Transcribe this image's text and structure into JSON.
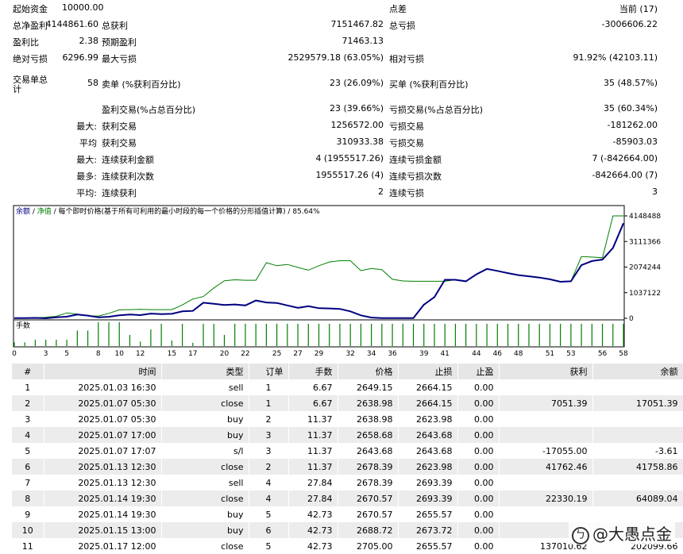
{
  "stats": {
    "initial_deposit": {
      "label": "起始资金",
      "value": "10000.00"
    },
    "spread": {
      "label": "点差",
      "value": "当前 (17)"
    },
    "net_profit": {
      "label": "总净盈利",
      "value": "4144861.60"
    },
    "gross_profit": {
      "label": "总获利",
      "value": "7151467.82"
    },
    "gross_loss": {
      "label": "总亏损",
      "value": "-3006606.22"
    },
    "profit_factor": {
      "label": "盈利比",
      "value": "2.38"
    },
    "expected_payoff": {
      "label": "预期盈利",
      "value": "71463.13"
    },
    "absolute_dd": {
      "label": "绝对亏损",
      "value": "6296.99"
    },
    "max_dd": {
      "label": "最大亏损",
      "value": "2529579.18 (63.05%)"
    },
    "relative_dd": {
      "label": "相对亏损",
      "value": "91.92% (42103.11)"
    },
    "total_trades": {
      "label": "交易单总计",
      "value": "58"
    },
    "short_positions": {
      "label": "卖单 (%获利百分比)",
      "value": "23 (26.09%)"
    },
    "long_positions": {
      "label": "买单 (%获利百分比)",
      "value": "35 (48.57%)"
    },
    "profit_trades": {
      "label": "盈利交易(%占总百分比)",
      "value": "23 (39.66%)"
    },
    "loss_trades": {
      "label": "亏损交易(%占总百分比)",
      "value": "35 (60.34%)"
    },
    "largest_prefix": "最大:",
    "largest_profit": {
      "label": "获利交易",
      "value": "1256572.00"
    },
    "largest_loss": {
      "label": "亏损交易",
      "value": "-181262.00"
    },
    "average_prefix": "平均",
    "average_profit": {
      "label": "获利交易",
      "value": "310933.38"
    },
    "average_loss": {
      "label": "亏损交易",
      "value": "-85903.03"
    },
    "max_prefix": "最大:",
    "max_consec_wins_money": {
      "label": "连续获利金额",
      "value": "4 (1955517.26)"
    },
    "max_consec_losses_money": {
      "label": "连续亏损金额",
      "value": "7 (-842664.00)"
    },
    "most_prefix": "最多:",
    "max_consec_profit_count": {
      "label": "连续获利次数",
      "value": "1955517.26 (4)"
    },
    "max_consec_loss_count": {
      "label": "连续亏损次数",
      "value": "-842664.00 (7)"
    },
    "avg_prefix": "平均:",
    "avg_consec_wins": {
      "label": "连续获利",
      "value": "2"
    },
    "avg_consec_losses": {
      "label": "连续亏损",
      "value": "3"
    }
  },
  "chart_data": {
    "type": "line",
    "legend": {
      "balance": "余额",
      "sep1": " / ",
      "equity": "净值",
      "note": " / 每个即时价格(基于所有可利用的最小时段的每一个价格的分形插值计算) / 85.64%"
    },
    "colors": {
      "balance": "#000080",
      "equity": "#008000",
      "lots": "#008000"
    },
    "y_ticks": [
      "4148488",
      "3111366",
      "2074244",
      "1037122",
      "0"
    ],
    "ylim": [
      0,
      4148488
    ],
    "x_ticks": [
      "0",
      "3",
      "5",
      "8",
      "10",
      "12",
      "15",
      "17",
      "20",
      "22",
      "25",
      "27",
      "29",
      "32",
      "34",
      "36",
      "39",
      "41",
      "44",
      "46",
      "48",
      "51",
      "53",
      "56",
      "58"
    ],
    "x_range": [
      0,
      58
    ],
    "lots_label": "手数",
    "series": [
      {
        "name": "balance",
        "x": [
          0,
          1,
          2,
          3,
          4,
          5,
          6,
          7,
          8,
          9,
          10,
          11,
          12,
          13,
          14,
          15,
          16,
          17,
          18,
          19,
          20,
          21,
          22,
          23,
          24,
          25,
          26,
          27,
          28,
          29,
          30,
          31,
          32,
          33,
          34,
          35,
          36,
          37,
          38,
          39,
          40,
          41,
          42,
          43,
          44,
          45,
          46,
          47,
          48,
          49,
          50,
          51,
          52,
          53,
          54,
          55,
          56,
          57,
          58
        ],
        "y": [
          10000,
          10000,
          17051,
          -3.61,
          41758,
          64089,
          150000,
          110000,
          40000,
          60000,
          120000,
          150000,
          130000,
          190000,
          170000,
          180000,
          280000,
          300000,
          630000,
          590000,
          540000,
          560000,
          520000,
          720000,
          640000,
          620000,
          520000,
          420000,
          490000,
          410000,
          400000,
          380000,
          280000,
          120000,
          30000,
          10000,
          10000,
          10000,
          10000,
          550000,
          860000,
          1560000,
          1560000,
          1500000,
          1780000,
          2000000,
          1920000,
          1830000,
          1750000,
          1700000,
          1650000,
          1580000,
          1480000,
          1500000,
          2150000,
          2320000,
          2380000,
          2850000,
          3850000
        ]
      },
      {
        "name": "equity",
        "x": [
          0,
          1,
          2,
          3,
          4,
          5,
          6,
          7,
          8,
          9,
          10,
          11,
          12,
          13,
          14,
          15,
          16,
          17,
          18,
          19,
          20,
          21,
          22,
          23,
          24,
          25,
          26,
          27,
          28,
          29,
          30,
          31,
          32,
          33,
          34,
          35,
          36,
          37,
          38,
          39,
          40,
          41,
          42,
          43,
          44,
          45,
          46,
          47,
          48,
          49,
          50,
          51,
          52,
          53,
          54,
          55,
          56,
          57,
          58
        ],
        "y": [
          10000,
          10000,
          17051,
          40000,
          80000,
          220000,
          170000,
          100000,
          90000,
          200000,
          340000,
          350000,
          360000,
          350000,
          350000,
          350000,
          540000,
          780000,
          880000,
          1230000,
          1520000,
          1560000,
          1540000,
          1540000,
          2250000,
          2130000,
          2180000,
          2060000,
          1950000,
          2130000,
          2280000,
          2330000,
          2330000,
          1930000,
          2020000,
          1970000,
          1580000,
          1510000,
          1500000,
          1500000,
          1500000,
          1500000,
          1560000,
          1500000,
          1780000,
          2000000,
          1920000,
          1830000,
          1750000,
          1700000,
          1650000,
          1580000,
          1480000,
          1500000,
          2500000,
          2480000,
          2450000,
          4148488,
          4148488
        ]
      }
    ],
    "lots": [
      6.67,
      6.67,
      11.37,
      11.37,
      11.37,
      11.37,
      27.84,
      27.84,
      42.73,
      42.73,
      42.73,
      20,
      8,
      30,
      40,
      10,
      40,
      6,
      40,
      40,
      20,
      40,
      40,
      40,
      40,
      40,
      40,
      40,
      40,
      40,
      40,
      40,
      40,
      40,
      40,
      40,
      40,
      40,
      40,
      40,
      40,
      40,
      40,
      40,
      40,
      40,
      40,
      40,
      40,
      40,
      40,
      40,
      40,
      40,
      40,
      40,
      40,
      40,
      40
    ]
  },
  "table": {
    "headers": [
      "#",
      "时间",
      "类型",
      "订单",
      "手数",
      "价格",
      "止损",
      "止盈",
      "获利",
      "余额"
    ],
    "rows": [
      [
        "1",
        "2025.01.03 16:30",
        "sell",
        "1",
        "6.67",
        "2649.15",
        "2664.15",
        "0.00",
        "",
        ""
      ],
      [
        "2",
        "2025.01.07 05:30",
        "close",
        "1",
        "6.67",
        "2638.98",
        "2664.15",
        "0.00",
        "7051.39",
        "17051.39"
      ],
      [
        "3",
        "2025.01.07 05:30",
        "buy",
        "2",
        "11.37",
        "2638.98",
        "2623.98",
        "0.00",
        "",
        ""
      ],
      [
        "4",
        "2025.01.07 17:00",
        "buy",
        "3",
        "11.37",
        "2658.68",
        "2643.68",
        "0.00",
        "",
        ""
      ],
      [
        "5",
        "2025.01.07 17:07",
        "s/l",
        "3",
        "11.37",
        "2643.68",
        "2643.68",
        "0.00",
        "-17055.00",
        "-3.61"
      ],
      [
        "6",
        "2025.01.13 12:30",
        "close",
        "2",
        "11.37",
        "2678.39",
        "2623.98",
        "0.00",
        "41762.46",
        "41758.86"
      ],
      [
        "7",
        "2025.01.13 12:30",
        "sell",
        "4",
        "27.84",
        "2678.39",
        "2693.39",
        "0.00",
        "",
        ""
      ],
      [
        "8",
        "2025.01.14 19:30",
        "close",
        "4",
        "27.84",
        "2670.57",
        "2693.39",
        "0.00",
        "22330.19",
        "64089.04"
      ],
      [
        "9",
        "2025.01.14 19:30",
        "buy",
        "5",
        "42.73",
        "2670.57",
        "2655.57",
        "0.00",
        "",
        ""
      ],
      [
        "10",
        "2025.01.15 13:00",
        "buy",
        "6",
        "42.73",
        "2688.72",
        "2673.72",
        "0.00",
        "",
        ""
      ],
      [
        "11",
        "2025.01.17 12:00",
        "close",
        "5",
        "42.73",
        "2705.00",
        "2655.57",
        "0.00",
        "137010.62",
        "202099.66"
      ]
    ]
  },
  "watermark": {
    "icon": "ㄅ",
    "text": "@大愚点金"
  }
}
